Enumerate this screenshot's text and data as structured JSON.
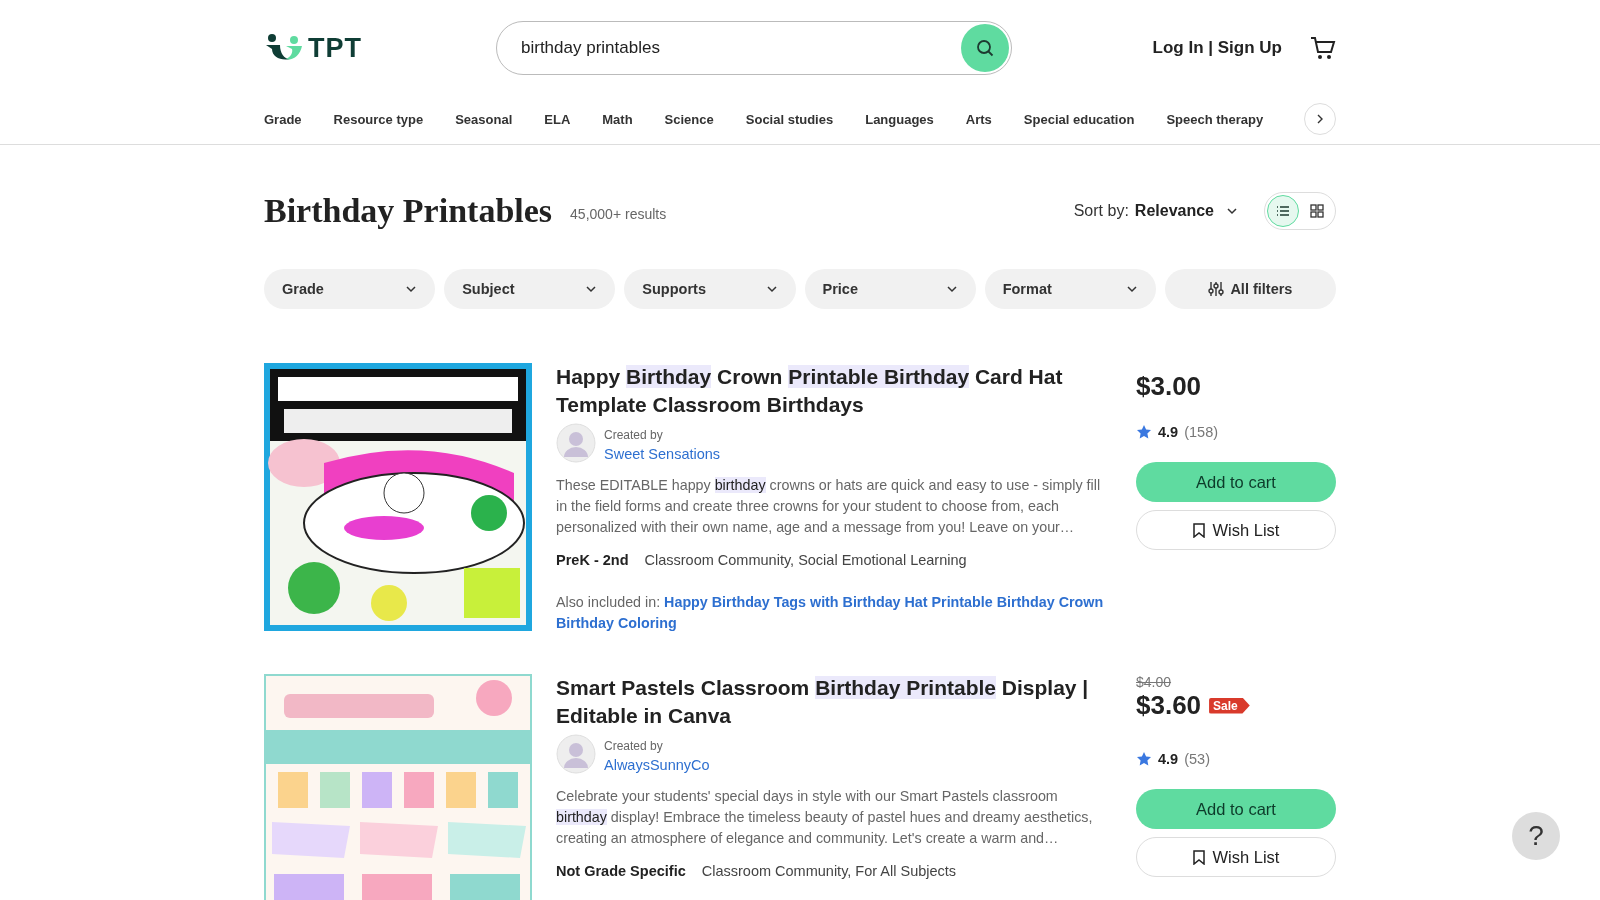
{
  "header": {
    "logo": "TPT",
    "search": {
      "value": "birthday printables"
    },
    "account_link": "Log In | Sign Up"
  },
  "nav": {
    "items": [
      "Grade",
      "Resource type",
      "Seasonal",
      "ELA",
      "Math",
      "Science",
      "Social studies",
      "Languages",
      "Arts",
      "Special education",
      "Speech therapy"
    ]
  },
  "results": {
    "title": "Birthday Printables",
    "count": "45,000+ results",
    "sort_label": "Sort by:",
    "sort_value": "Relevance",
    "views": [
      {
        "kind": "list",
        "selected": true
      },
      {
        "kind": "grid",
        "selected": false
      }
    ]
  },
  "filters": [
    {
      "kind": "dropdown",
      "label": "Grade"
    },
    {
      "kind": "dropdown",
      "label": "Subject"
    },
    {
      "kind": "dropdown",
      "label": "Supports"
    },
    {
      "kind": "dropdown",
      "label": "Price"
    },
    {
      "kind": "dropdown",
      "label": "Format"
    },
    {
      "kind": "all",
      "label": "All filters"
    }
  ],
  "products": [
    {
      "title": [
        {
          "text": "Happy ",
          "highlighted": false
        },
        {
          "text": "Birthday",
          "highlighted": true
        },
        {
          "text": " Crown ",
          "highlighted": false
        },
        {
          "text": "Printable Birthday",
          "highlighted": true
        },
        {
          "text": " Card Hat Template Classroom Birthdays",
          "highlighted": false
        }
      ],
      "created_by": "Created by",
      "author": "Sweet Sensations",
      "description": [
        {
          "text": "These EDITABLE happy ",
          "highlighted": false
        },
        {
          "text": "birthday",
          "highlighted": true
        },
        {
          "text": " crowns or hats are quick and easy to use - simply fill in the field forms and create three crowns for your student to choose from, each personalized with their own name, age and a message from you! Leave on your…",
          "highlighted": false
        }
      ],
      "grade": "PreK - 2nd",
      "subjects": "Classroom Community, Social Emotional Learning",
      "also_label": "Also included in:",
      "also_link": "Happy Birthday Tags with Birthday Hat Printable Birthday Crown Birthday Coloring",
      "price": "$3.00",
      "rating": "4.9",
      "reviews": "(158)",
      "cart": "Add to cart",
      "wish": "Wish List"
    },
    {
      "title": [
        {
          "text": "Smart Pastels Classroom ",
          "highlighted": false
        },
        {
          "text": "Birthday Printable",
          "highlighted": true
        },
        {
          "text": " Display | Editable in Canva",
          "highlighted": false
        }
      ],
      "created_by": "Created by",
      "author": "AlwaysSunnyCo",
      "description": [
        {
          "text": "Celebrate your students' special days in style with our Smart Pastels classroom ",
          "highlighted": false
        },
        {
          "text": "birthday",
          "highlighted": true
        },
        {
          "text": " display! Embrace the timeless beauty of pastel hues and dreamy aesthetics, creating an atmosphere of elegance and community. Let's create a warm and…",
          "highlighted": false
        }
      ],
      "grade": "Not Grade Specific",
      "subjects": "Classroom Community, For All Subjects",
      "old_price": "$4.00",
      "price": "$3.60",
      "sale": "Sale",
      "rating": "4.9",
      "reviews": "(53)",
      "cart": "Add to cart",
      "wish": "Wish List"
    }
  ],
  "help": "?"
}
